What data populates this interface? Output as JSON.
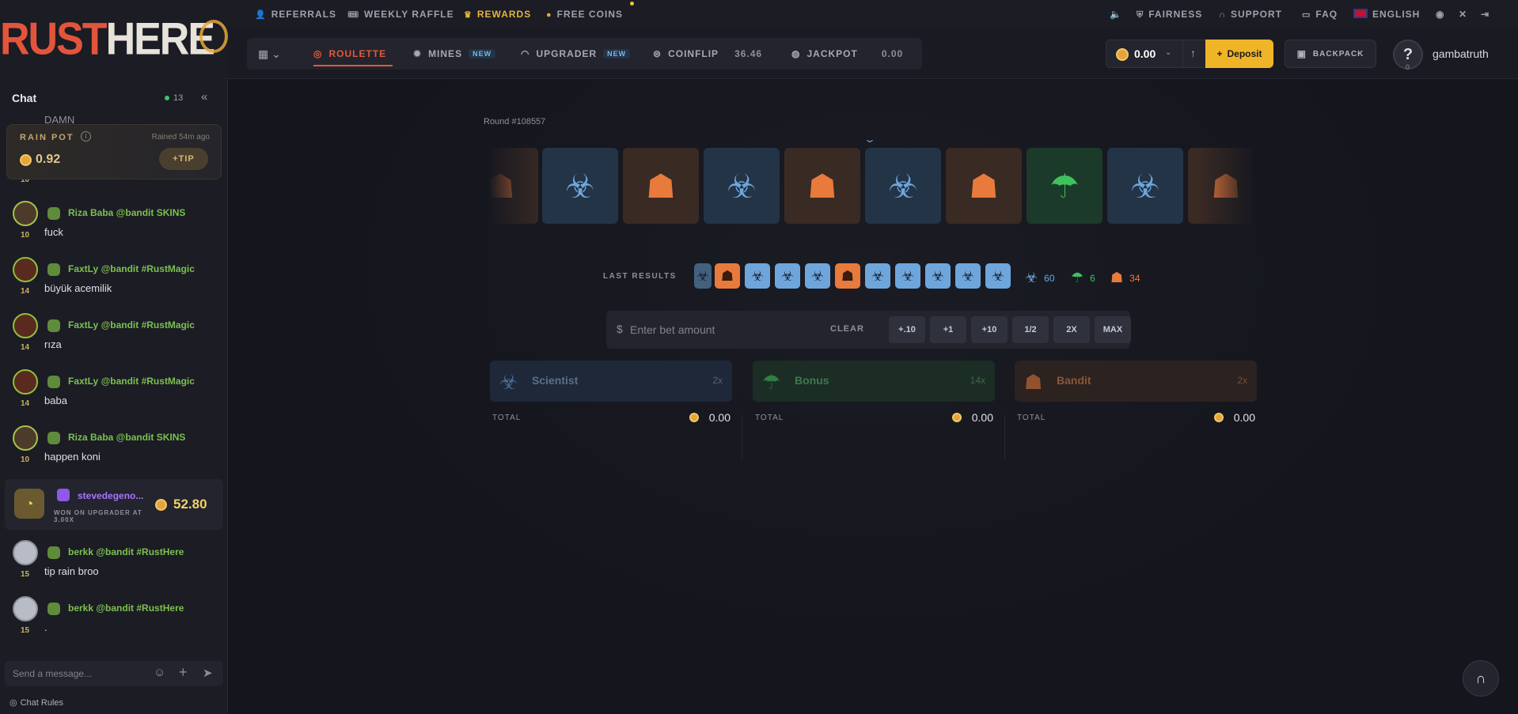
{
  "brand": {
    "logo_rust": "RUST",
    "logo_here": "HERE"
  },
  "top_nav": {
    "referrals": "REFERRALS",
    "weekly_raffle": "WEEKLY RAFFLE",
    "rewards": "REWARDS",
    "free_coins": "FREE COINS",
    "fairness": "FAIRNESS",
    "support": "SUPPORT",
    "faq": "FAQ",
    "language": "ENGLISH"
  },
  "game_tabs": {
    "roulette": "ROULETTE",
    "mines": "MINES",
    "mines_tag": "NEW",
    "upgrader": "UPGRADER",
    "upgrader_tag": "NEW",
    "coinflip": "COINFLIP",
    "coinflip_value": "36.46",
    "jackpot": "JACKPOT",
    "jackpot_value": "0.00"
  },
  "account": {
    "balance": "0.00",
    "deposit_label": "Deposit",
    "backpack_label": "BACKPACK",
    "avatar_glyph": "?",
    "level": "0",
    "username": "gambatruth"
  },
  "chat": {
    "title": "Chat",
    "online_count": "13",
    "rain_pot": {
      "label": "RAIN POT",
      "rained": "Rained 54m ago",
      "amount": "0.92",
      "tip_label": "TIP"
    },
    "partial_top": "DAMN",
    "partial_level": "10",
    "messages": [
      {
        "level": "10",
        "name": "Riza Baba @bandit SKINS",
        "text": "fuck"
      },
      {
        "level": "14",
        "name": "FaxtLy @bandit #RustMagic",
        "text": "büyük acemilik"
      },
      {
        "level": "14",
        "name": "FaxtLy @bandit #RustMagic",
        "text": "rıza"
      },
      {
        "level": "14",
        "name": "FaxtLy @bandit #RustMagic",
        "text": "baba"
      },
      {
        "level": "10",
        "name": "Riza Baba @bandit SKINS",
        "text": "happen koni"
      },
      {
        "level": "15",
        "name": "berkk @bandit #RustHere",
        "text": "tip rain broo"
      },
      {
        "level": "15",
        "name": "berkk @bandit #RustHere",
        "text": "."
      }
    ],
    "win": {
      "name": "stevedegeno...",
      "subtitle": "WON ON UPGRADER AT 3.00X",
      "amount": "52.80"
    },
    "input_placeholder": "Send a message...",
    "rules_label": "Chat Rules"
  },
  "roulette": {
    "round": "Round #108557",
    "last_results_label": "LAST RESULTS",
    "counts": {
      "scientist": "60",
      "bonus": "6",
      "bandit": "34"
    },
    "bet": {
      "placeholder": "Enter bet amount",
      "clear": "CLEAR",
      "quick": [
        "+.10",
        "+1",
        "+10",
        "1/2",
        "2X",
        "MAX"
      ]
    },
    "options": [
      {
        "name": "Scientist",
        "multiplier": "2x",
        "total_label": "TOTAL",
        "total": "0.00"
      },
      {
        "name": "Bonus",
        "multiplier": "14x",
        "total_label": "TOTAL",
        "total": "0.00"
      },
      {
        "name": "Bandit",
        "multiplier": "2x",
        "total_label": "TOTAL",
        "total": "0.00"
      }
    ]
  },
  "colors": {
    "accent_orange": "#e4573c",
    "rewards_gold": "#e4b53a",
    "deposit_yellow": "#f0b429",
    "scientist_blue": "#6ea6dc",
    "bandit_orange": "#e87a3c",
    "bonus_green": "#3fc25d"
  }
}
